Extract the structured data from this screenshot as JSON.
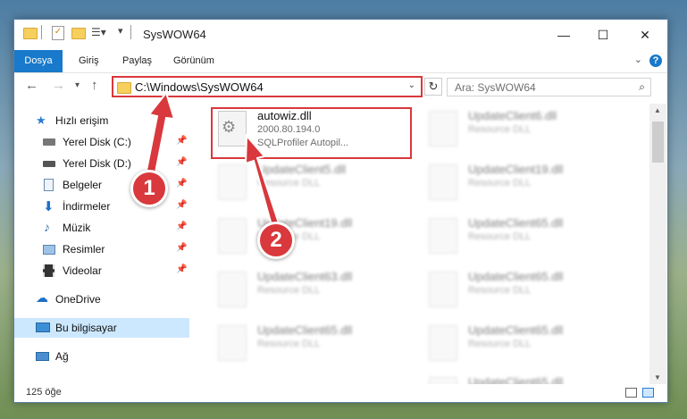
{
  "window": {
    "title": "SysWOW64"
  },
  "ribbon": {
    "tabs": [
      "Dosya",
      "Giriş",
      "Paylaş",
      "Görünüm"
    ]
  },
  "address": {
    "path": "C:\\Windows\\SysWOW64"
  },
  "search": {
    "placeholder": "Ara: SysWOW64"
  },
  "sidebar": {
    "quick_access": "Hızlı erişim",
    "items": [
      "Yerel Disk (C:)",
      "Yerel Disk (D:)",
      "Belgeler",
      "İndirmeler",
      "Müzik",
      "Resimler",
      "Videolar"
    ],
    "onedrive": "OneDrive",
    "this_pc": "Bu bilgisayar",
    "network": "Ağ"
  },
  "highlighted_file": {
    "name": "autowiz.dll",
    "version": "2000.80.194.0",
    "description": "SQLProfiler Autopil..."
  },
  "background_files": [
    {
      "name": "UpdateClient6.dll",
      "type": "Resource DLL"
    },
    {
      "name": "UpdateClient5.dll",
      "type": "Resource DLL"
    },
    {
      "name": "UpdateClient19.dll",
      "type": "Resource DLL"
    },
    {
      "name": "UpdateClient19.dll",
      "type": "Resource DLL"
    },
    {
      "name": "UpdateClient65.dll",
      "type": "Resource DLL"
    },
    {
      "name": "UpdateClient63.dll",
      "type": "Resource DLL"
    },
    {
      "name": "UpdateClient65.dll",
      "type": "Resource DLL"
    },
    {
      "name": "UpdateClient65.dll",
      "type": "Resource DLL"
    },
    {
      "name": "UpdateClient65.dll",
      "type": "Resource DLL"
    },
    {
      "name": "UpdateClient65.dll",
      "type": "Resource DLL"
    }
  ],
  "status": {
    "count": "125 öğe"
  },
  "annotations": {
    "step1": "1",
    "step2": "2",
    "color": "#d9383c"
  }
}
